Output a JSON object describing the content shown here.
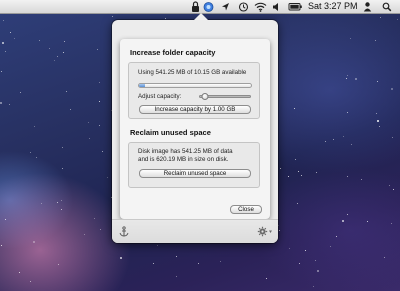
{
  "menubar": {
    "clock": "Sat 3:27 PM",
    "icons": [
      "lock-icon",
      "app-status-icon",
      "location-arrow-icon",
      "time-machine-icon",
      "wifi-icon",
      "volume-icon",
      "battery-icon",
      "user-icon",
      "spotlight-icon"
    ]
  },
  "popover": {
    "increase": {
      "title": "Increase folder capacity",
      "usage_text": "Using 541.25 MB of 10.15 GB available",
      "usage_fraction": 0.053,
      "adjust_label": "Adjust capacity:",
      "slider_fraction": 0.1,
      "button_label": "Increase capacity by 1.00 GB"
    },
    "reclaim": {
      "title": "Reclaim unused space",
      "info_line1": "Disk image has 541.25 MB of data",
      "info_line2": "and is 620.19 MB in size on disk.",
      "button_label": "Reclaim unused space"
    },
    "close_label": "Close",
    "footer_icons": [
      "anchor-icon",
      "gear-icon"
    ]
  },
  "colors": {
    "accent": "#5a90d6",
    "menubar": "#e6e6e6",
    "panel": "#ececec"
  }
}
